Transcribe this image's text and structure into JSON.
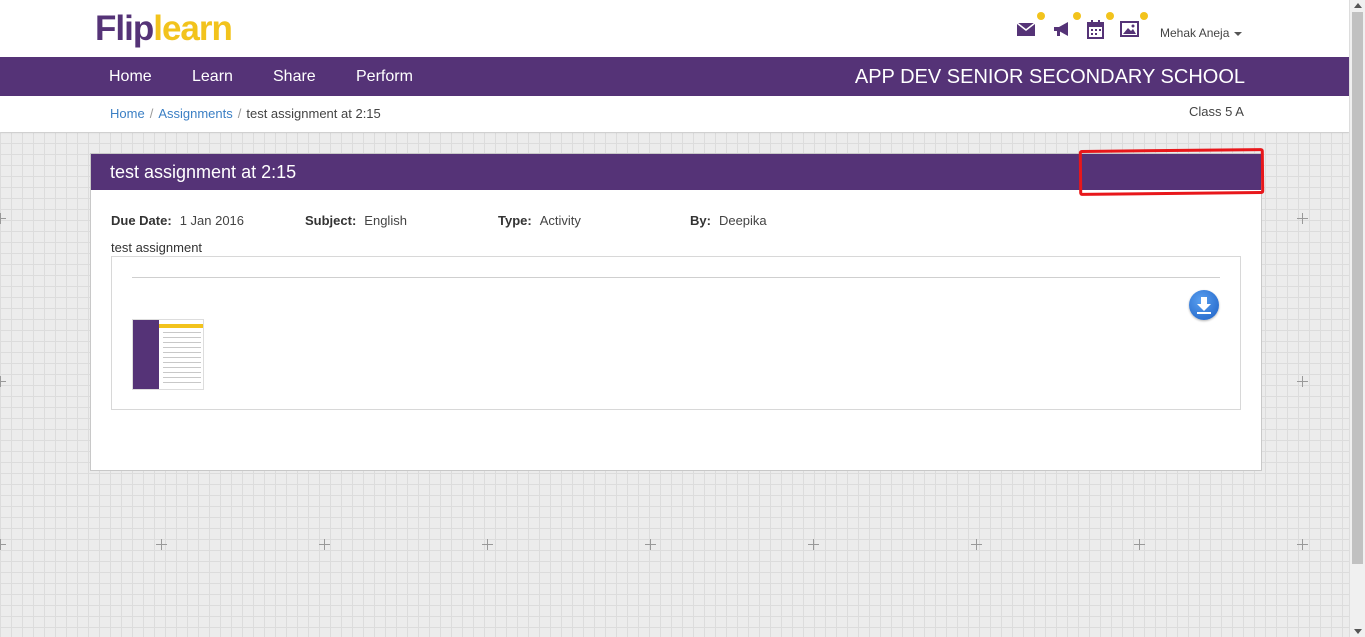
{
  "header": {
    "logo_part1": "Flip",
    "logo_part2": "learn",
    "user_name": "Mehak Aneja",
    "icons": [
      "mail-icon",
      "megaphone-icon",
      "calendar-icon",
      "image-icon"
    ]
  },
  "nav": {
    "items": [
      "Home",
      "Learn",
      "Share",
      "Perform"
    ],
    "school_name": "APP DEV SENIOR SECONDARY SCHOOL"
  },
  "breadcrumb": {
    "home": "Home",
    "assignments": "Assignments",
    "current": "test assignment at 2:15",
    "class_label": "Class 5 A"
  },
  "assignment": {
    "title": "test assignment at 2:15",
    "due_date_label": "Due Date:",
    "due_date": "1 Jan 2016",
    "subject_label": "Subject:",
    "subject": "English",
    "type_label": "Type:",
    "type": "Activity",
    "by_label": "By:",
    "by": "Deepika",
    "description": "test assignment"
  },
  "colors": {
    "brand_purple": "#553377",
    "brand_yellow": "#f2c31c",
    "link_blue": "#3b7fc4",
    "annotation_red": "#e8171b"
  }
}
